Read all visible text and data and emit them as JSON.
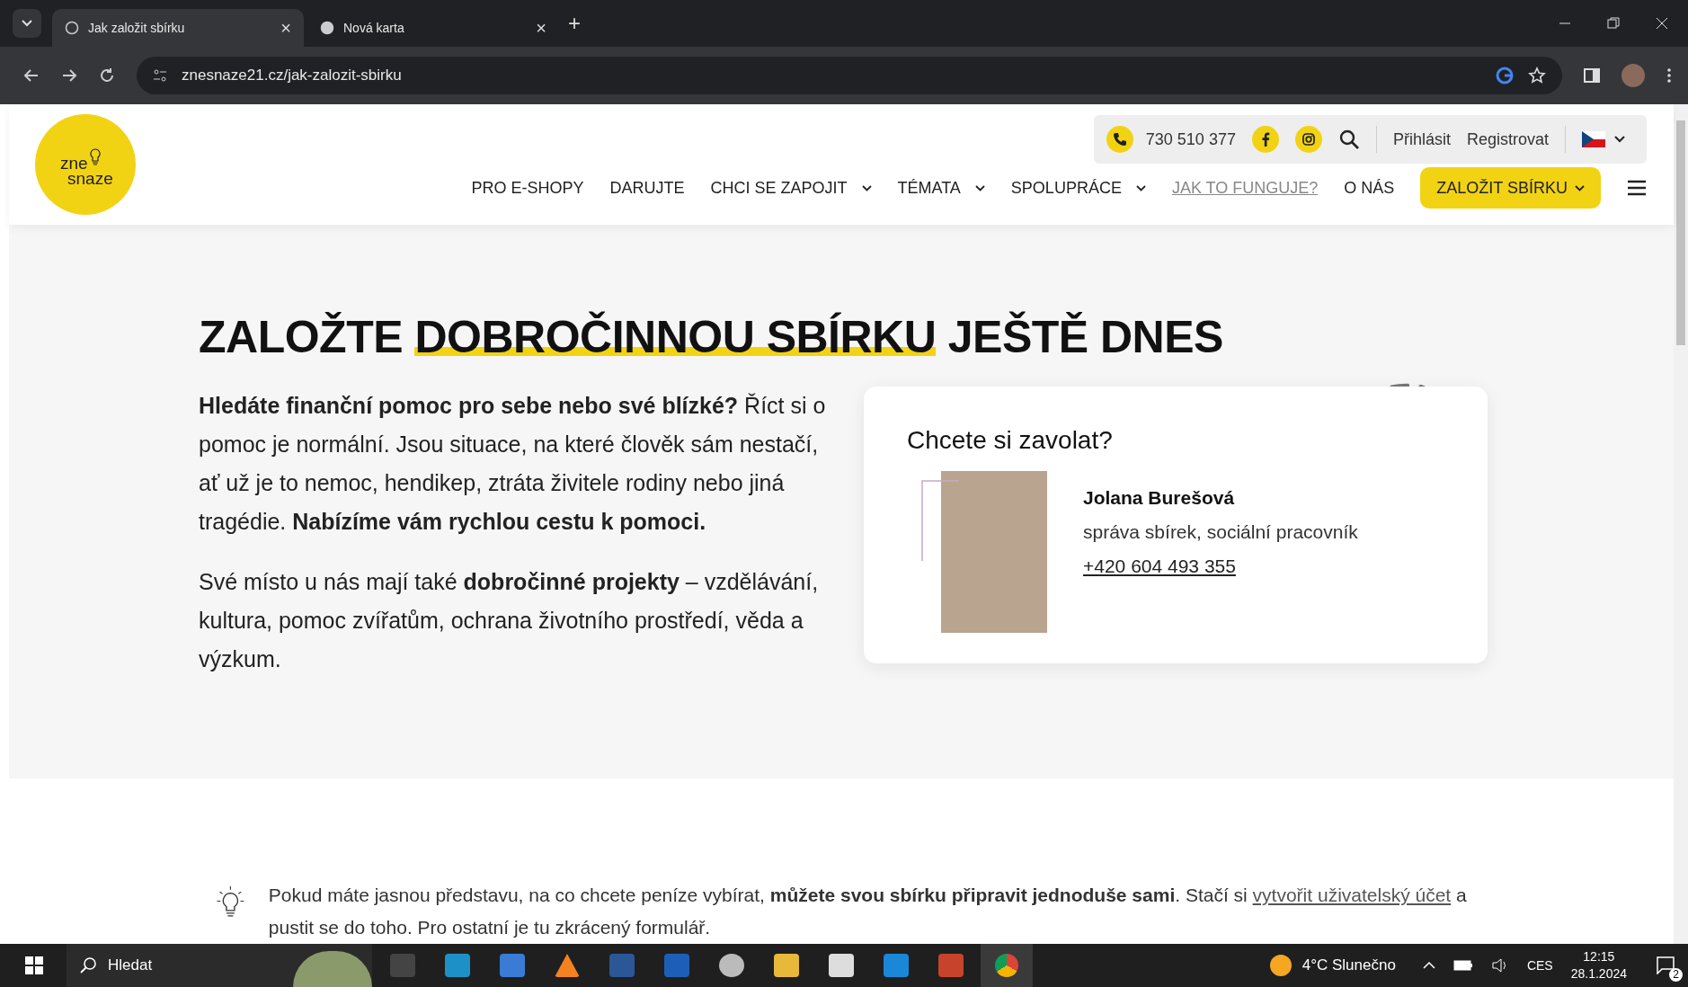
{
  "browser": {
    "tabs": [
      {
        "title": "Jak založit sbírku",
        "selected": true,
        "close": "×"
      },
      {
        "title": "Nová karta",
        "selected": false,
        "close": "×"
      }
    ],
    "new_tab": "+",
    "url": "znesnaze21.cz/jak-zalozit-sbirku"
  },
  "header": {
    "logo": [
      "zne",
      "snaze"
    ],
    "phone": "730 510 377",
    "login": "Přihlásit",
    "register": "Registrovat",
    "nav": [
      {
        "label": "PRO E-SHOPY",
        "has_menu": false,
        "selected": false
      },
      {
        "label": "DARUJTE",
        "has_menu": false,
        "selected": false
      },
      {
        "label": "CHCI SE ZAPOJIT",
        "has_menu": true,
        "selected": false
      },
      {
        "label": "TÉMATA",
        "has_menu": true,
        "selected": false
      },
      {
        "label": "SPOLUPRÁCE",
        "has_menu": true,
        "selected": false
      },
      {
        "label": "JAK TO FUNGUJE?",
        "has_menu": false,
        "selected": true
      },
      {
        "label": "O NÁS",
        "has_menu": false,
        "selected": false
      }
    ],
    "cta": "ZALOŽIT SBÍRKU"
  },
  "hero": {
    "heading": [
      {
        "text": "ZALOŽTE ",
        "highlight": false
      },
      {
        "text": "DOBROČINNOU SBÍRKU",
        "highlight": true
      },
      {
        "text": " JEŠTĚ DNES",
        "highlight": false
      }
    ],
    "paragraphs": [
      "**Hledáte finanční pomoc pro sebe nebo své blízké?** Říct si o pomoc je normální. Jsou situace, na které člověk sám nestačí, ať už je to nemoc, hendikep, ztráta živitele rodiny nebo jiná tragédie. **Nabízíme vám rychlou cestu k pomoci.**",
      "Své místo u nás mají také **dobročinné projekty** – vzdělávání, kultura, pomoc zvířatům, ochrana životního prostředí, věda a výzkum."
    ],
    "card": {
      "title": "Chcete si zavolat?",
      "name": "Jolana Burešová",
      "role": "správa sbírek, sociální pracovník",
      "phone": "+420 604 493 355"
    }
  },
  "info": {
    "before": "Pokud máte jasnou představu, na co chcete peníze vybírat, **můžete svou sbírku připravit jednoduše sami**. Stačí si ",
    "link": "vytvořit uživatelský účet",
    "after": " a pustit se do toho. Pro ostatní je tu zkrácený formulář."
  },
  "taskbar": {
    "search": "Hledat",
    "weather": "4°C  Slunečno",
    "language": "CES",
    "time": "12:15",
    "date": "28.1.2024",
    "notifications": "2"
  }
}
